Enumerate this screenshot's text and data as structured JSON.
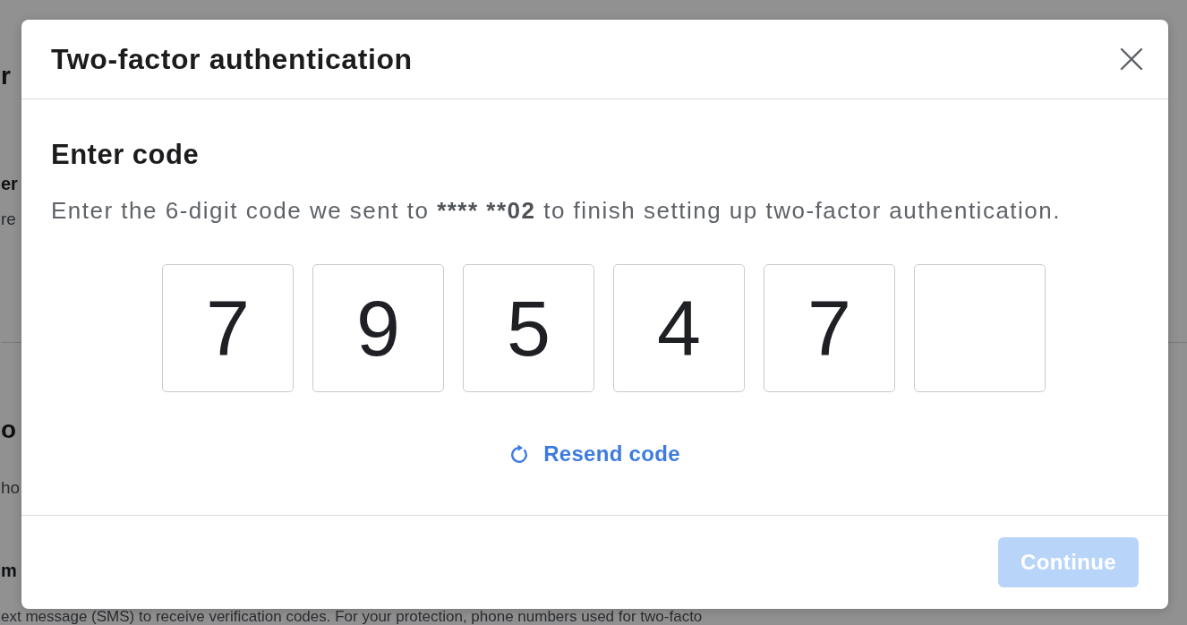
{
  "background": {
    "sections": [
      {
        "heading": "r",
        "options": [
          {
            "title": "er",
            "description": "re"
          }
        ]
      },
      {
        "heading": "o",
        "description": "ho",
        "options": [
          {
            "title": "m",
            "description": "ext message (SMS) to receive verification codes. For your protection, phone numbers used for two-facto"
          }
        ]
      }
    ]
  },
  "dialog": {
    "title": "Two-factor authentication",
    "heading": "Enter code",
    "instructions": {
      "before": "Enter the 6-digit code we sent to ",
      "phone": "**** **02",
      "after": " to finish setting up two-factor authentication."
    },
    "code_boxes": [
      {
        "kind": "digit",
        "value": "7"
      },
      {
        "kind": "digit",
        "value": "9"
      },
      {
        "kind": "digit",
        "value": "5"
      },
      {
        "kind": "digit",
        "value": "4"
      },
      {
        "kind": "digit",
        "value": "7"
      },
      {
        "kind": "empty"
      }
    ],
    "resend_link": "Resend code",
    "continue_button": {
      "label": "Continue",
      "disabled": true
    }
  }
}
